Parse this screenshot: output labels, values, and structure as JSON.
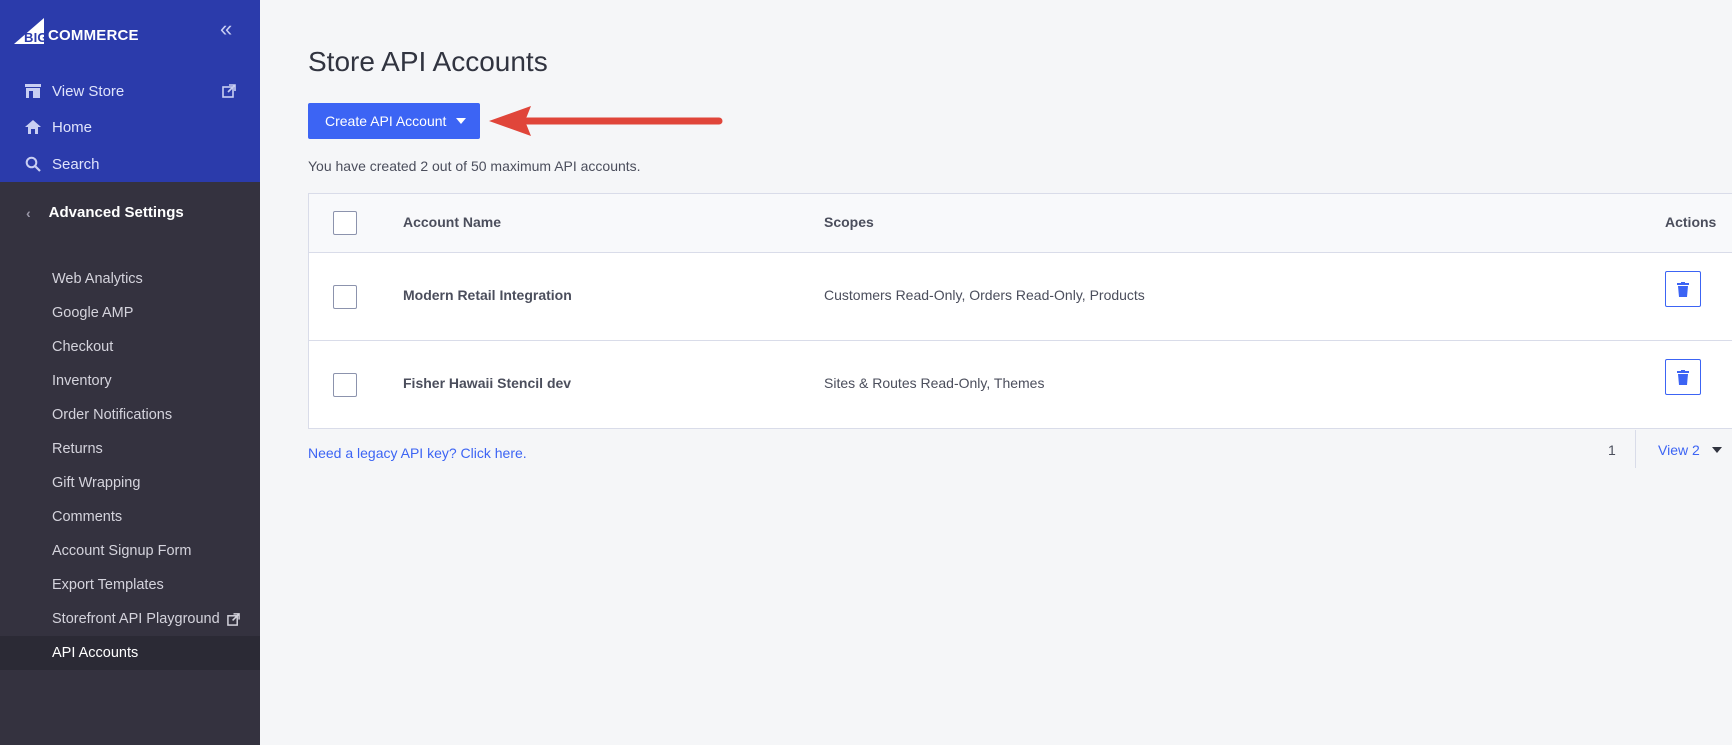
{
  "brand": {
    "logo_text": "COMMERCE",
    "logo_prefix": "BIG"
  },
  "sidebar": {
    "top_links": [
      {
        "label": "View Store",
        "icon": "store-icon"
      },
      {
        "label": "Home",
        "icon": "home-icon"
      },
      {
        "label": "Search",
        "icon": "search-icon"
      }
    ],
    "section_title": "Advanced Settings",
    "items": [
      {
        "label": "Web Analytics"
      },
      {
        "label": "Google AMP"
      },
      {
        "label": "Checkout"
      },
      {
        "label": "Inventory"
      },
      {
        "label": "Order Notifications"
      },
      {
        "label": "Returns"
      },
      {
        "label": "Gift Wrapping"
      },
      {
        "label": "Comments"
      },
      {
        "label": "Account Signup Form"
      },
      {
        "label": "Export Templates"
      },
      {
        "label": "Storefront API Playground"
      },
      {
        "label": "API Accounts"
      }
    ]
  },
  "main": {
    "title": "Store API Accounts",
    "create_button": "Create API Account",
    "count_text": "You have created 2 out of 50 maximum API accounts.",
    "table": {
      "headers": {
        "name": "Account Name",
        "scopes": "Scopes",
        "actions": "Actions"
      },
      "rows": [
        {
          "name": "Modern Retail Integration",
          "scopes": "Customers Read-Only, Orders Read-Only, Products"
        },
        {
          "name": "Fisher Hawaii Stencil dev",
          "scopes": "Sites & Routes Read-Only, Themes"
        }
      ]
    },
    "legacy_link": "Need a legacy API key? Click here.",
    "pagination": {
      "page": "1",
      "view": "View 2"
    }
  },
  "colors": {
    "brand_blue": "#3c64f4",
    "sidebar_top": "#2b3bab",
    "sidebar_bg": "#34323f",
    "arrow_red": "#e0453a"
  }
}
